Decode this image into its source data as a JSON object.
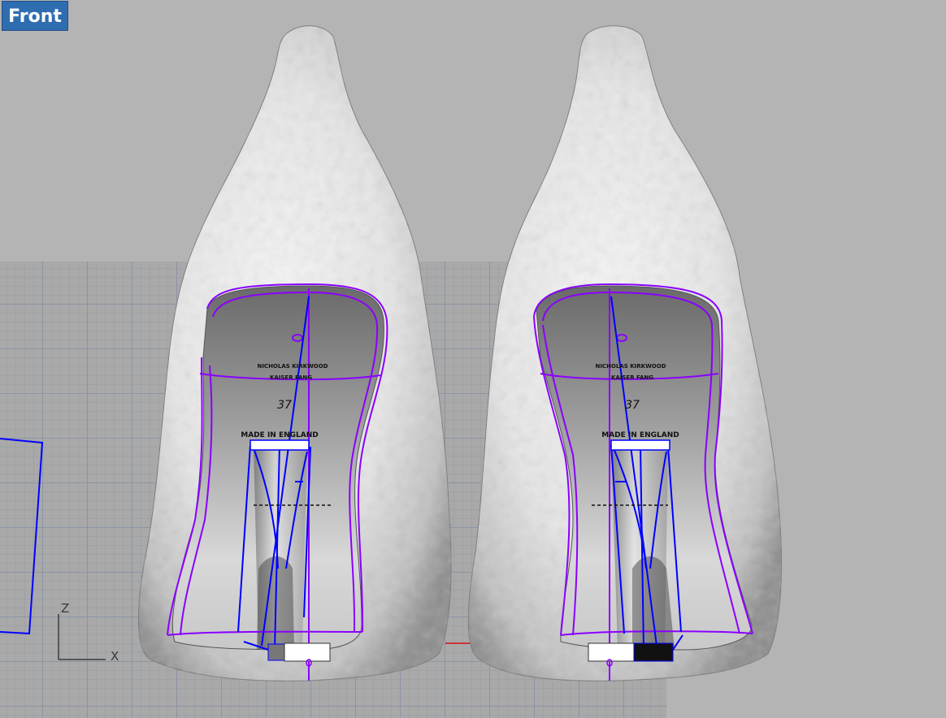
{
  "viewport": {
    "label": "Front",
    "colors": {
      "label_bg": "#2f6db1",
      "background": "#b4b4b4",
      "grid": "#a9a9a9",
      "curve_purple": "#8a00ff",
      "curve_blue": "#0000ff",
      "axis_x": "#cc3333"
    }
  },
  "axes": {
    "z_label": "Z",
    "x_label": "X"
  },
  "shoes": [
    {
      "text_line1": "NICHOLAS KIRKWOOD",
      "text_line2": "KAISER FANG",
      "size": "37",
      "made_in": "MADE IN ENGLAND"
    },
    {
      "text_line1": "NICHOLAS KIRKWOOD",
      "text_line2": "KAISER FANG",
      "size": "37",
      "made_in": "MADE IN ENGLAND"
    }
  ]
}
